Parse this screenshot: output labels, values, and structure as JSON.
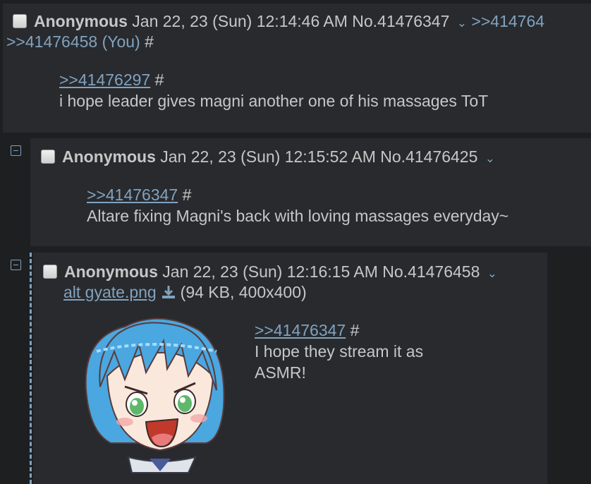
{
  "posts": [
    {
      "name": "Anonymous",
      "date": "Jan 22, 23 (Sun) 12:14:46 AM",
      "num": "No.41476347",
      "menu": "⌄",
      "backlink_right": ">>414764",
      "backlink_you": ">>41476458 (You)",
      "backlink_hash": "#",
      "quote": ">>41476297",
      "quote_hash": "#",
      "text": "i hope leader gives magni another one of his massages ToT"
    },
    {
      "name": "Anonymous",
      "date": "Jan 22, 23 (Sun) 12:15:52 AM",
      "num": "No.41476425",
      "menu": "⌄",
      "quote": ">>41476347",
      "quote_hash": "#",
      "text": "Altare fixing Magni's back with loving massages everyday~"
    },
    {
      "name": "Anonymous",
      "date": "Jan 22, 23 (Sun) 12:16:15 AM",
      "num": "No.41476458",
      "menu": "⌄",
      "file_name": "alt gyate.png",
      "file_meta": "(94 KB, 400x400)",
      "quote": ">>41476347",
      "quote_hash": "#",
      "text_line1": "I hope they stream it as",
      "text_line2": "ASMR!"
    }
  ],
  "colors": {
    "background": "#1d1f21",
    "post_bg": "#282a2e",
    "link": "#81a2be",
    "text": "#c5c8c6"
  },
  "icons": {
    "collapse": "minus-box-icon",
    "download": "download-icon",
    "menu": "chevron-down-icon"
  }
}
